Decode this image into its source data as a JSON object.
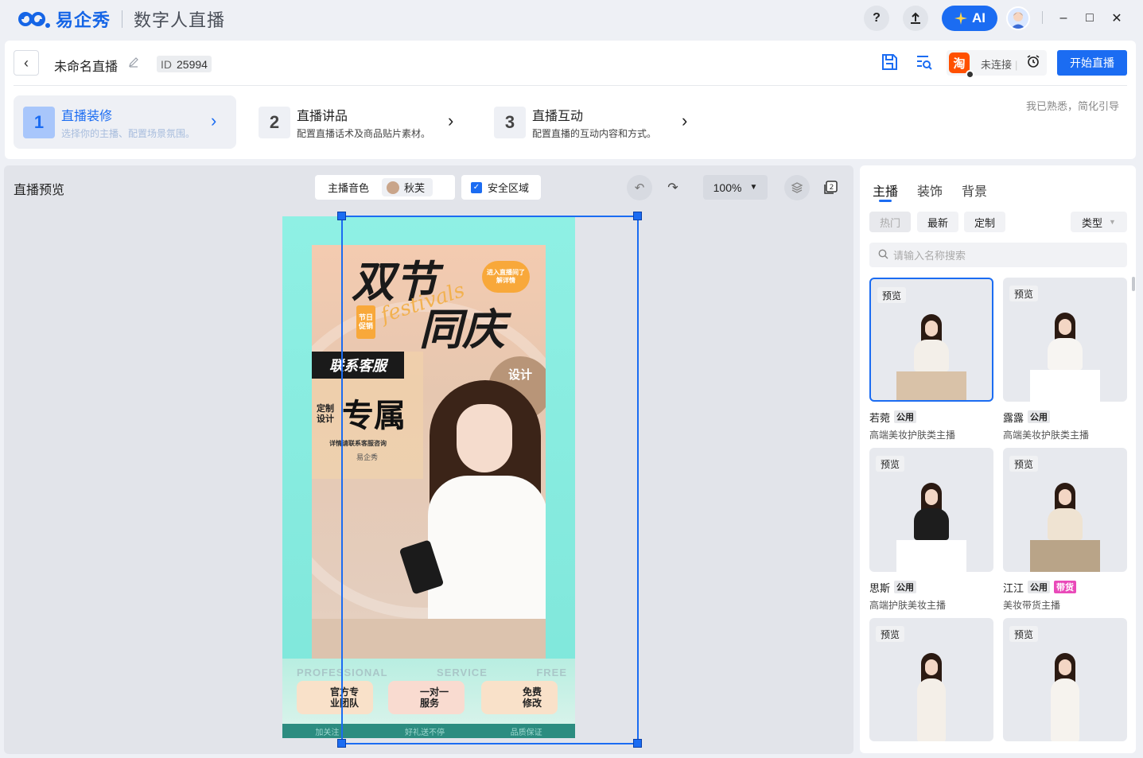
{
  "app": {
    "brand": "易企秀",
    "name": "数字人直播"
  },
  "titlebar": {
    "help": "?",
    "ai_label": "AI",
    "minimize": "–",
    "maximize": "□",
    "close": "✕"
  },
  "header": {
    "title": "未命名直播",
    "id_label": "ID",
    "id_value": "25994",
    "taobao": "淘",
    "status": "未连接",
    "start_label": "开始直播",
    "simplify_link": "我已熟悉，简化引导"
  },
  "steps": [
    {
      "num": "1",
      "title": "直播装修",
      "desc": "选择你的主播、配置场景氛围。"
    },
    {
      "num": "2",
      "title": "直播讲品",
      "desc": "配置直播话术及商品贴片素材。"
    },
    {
      "num": "3",
      "title": "直播互动",
      "desc": "配置直播的互动内容和方式。"
    }
  ],
  "preview": {
    "title": "直播预览",
    "voice_label": "主播音色",
    "voice_value": "秋芙",
    "safe_area_label": "安全区域",
    "zoom": "100%",
    "layer_badge": "2"
  },
  "poster": {
    "headline1": "双节",
    "headline2": "同庆",
    "script": "festivals",
    "badge": "进入直播间了解详情",
    "tag": "节日促销",
    "contact": "联系客服",
    "custom": "定制设计",
    "exclusive": "专属",
    "consult": "详情请联系客服咨询",
    "small_brand": "易企秀",
    "design": "设计",
    "bottom_en": [
      "PROFESSIONAL",
      "SERVICE",
      "FREE"
    ],
    "features": [
      "官方专业团队",
      "一对一服务",
      "免费修改"
    ],
    "footer": [
      "加关注",
      "好礼送不停",
      "品质保证"
    ]
  },
  "right": {
    "tabs": [
      "主播",
      "装饰",
      "背景"
    ],
    "filters": [
      "热门",
      "最新",
      "定制"
    ],
    "type_label": "类型",
    "search_placeholder": "请输入名称搜索",
    "preview_label": "预览",
    "hosts": [
      {
        "name": "若菀",
        "tags": [
          "公用"
        ],
        "desc": "高端美妆护肤类主播",
        "outfit": "#f3efe9",
        "desk": "#d9c2a8"
      },
      {
        "name": "露露",
        "tags": [
          "公用"
        ],
        "desc": "高端美妆护肤类主播",
        "outfit": "#f7f5f2",
        "desk": "#ffffff"
      },
      {
        "name": "思斯",
        "tags": [
          "公用"
        ],
        "desc": "高端护肤美妆主播",
        "outfit": "#1d1d1d",
        "desk": "#ffffff"
      },
      {
        "name": "江江",
        "tags": [
          "公用",
          "带货"
        ],
        "desc": "美妆带货主播",
        "outfit": "#efe3d2",
        "desk": "#b9a488"
      },
      {
        "name": "",
        "tags": [],
        "desc": "",
        "outfit": "#f4efe8",
        "desk": ""
      },
      {
        "name": "",
        "tags": [],
        "desc": "",
        "outfit": "#f6f3ee",
        "desk": ""
      }
    ]
  },
  "colors": {
    "accent": "#1b6cf2",
    "taobao": "#ff5000",
    "tag_pink": "#e94ab9",
    "canvas_bg": "#7fe8dd"
  }
}
